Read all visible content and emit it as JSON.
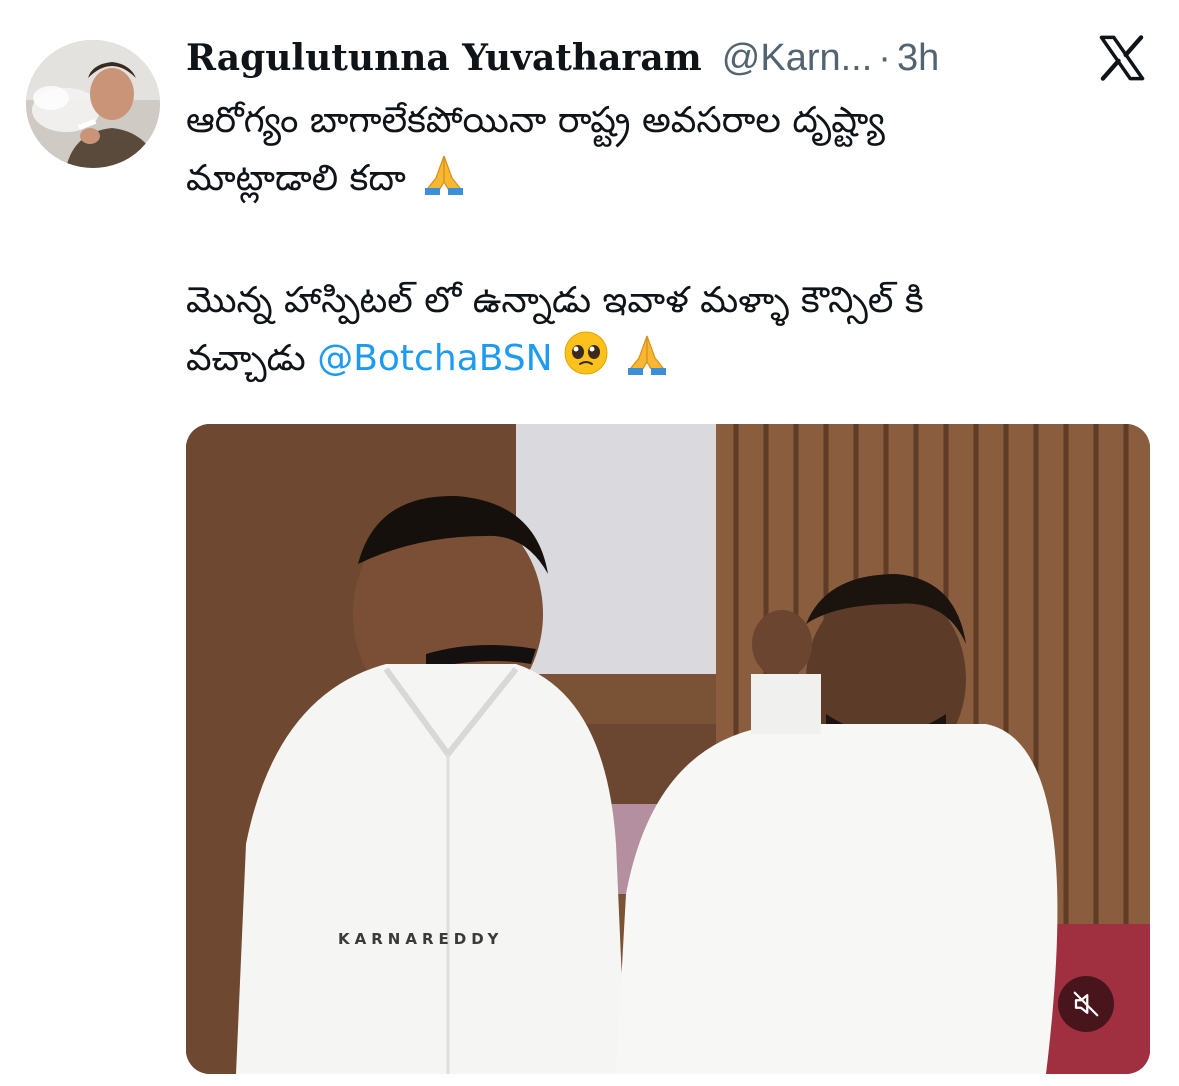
{
  "tweet": {
    "author_name": "Ragulutunna Yuvatharam",
    "handle": "@Karn...",
    "separator": "·",
    "time": "3h",
    "text_line_1": "ఆరోగ్యం బాగాలేకపోయినా రాష్ట్ర అవసరాల దృష్ట్యా",
    "text_line_2": "మాట్లాడాలి కదా",
    "text_line_3": "మొన్న హాస్పిటల్ లో ఉన్నాడు ఇవాళ మళ్ళా కౌన్సిల్ కి",
    "text_line_4": "వచ్చాడు",
    "mention": "@BotchaBSN",
    "emoji_1": "folded-hands",
    "emoji_2": "pleading-face",
    "emoji_3": "folded-hands"
  },
  "media": {
    "watermark": "KARNAREDDY",
    "mute_icon": "speaker-muted-icon"
  },
  "colors": {
    "text": "#0f1419",
    "secondary": "#536471",
    "link": "#1d9bf0"
  },
  "icons": {
    "logo": "x-logo-icon"
  }
}
